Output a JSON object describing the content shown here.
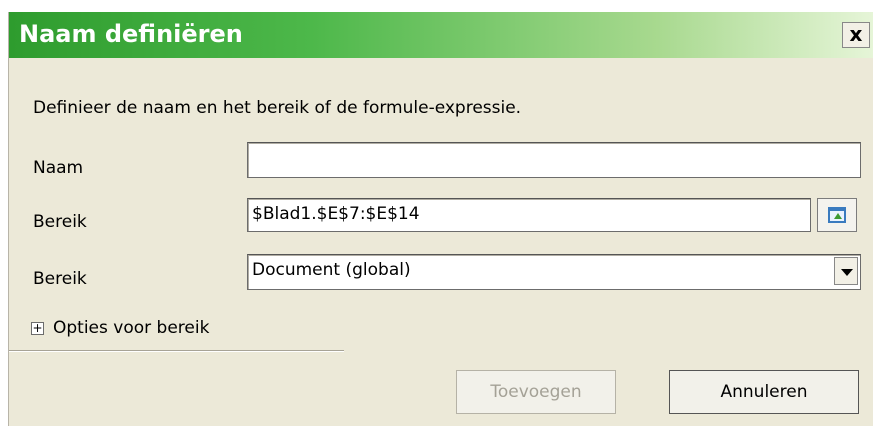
{
  "window": {
    "title": "Naam definiëren",
    "close_label": "x"
  },
  "description": "Definieer de naam en het bereik of de formule-expressie.",
  "fields": {
    "name_label": "Naam",
    "name_value": "",
    "range_label": "Bereik",
    "range_value": "$Blad1.$E$7:$E$14",
    "scope_label": "Bereik",
    "scope_value": "Document (global)"
  },
  "options": {
    "expand_symbol": "+",
    "label": "Opties voor bereik"
  },
  "buttons": {
    "add_label": "Toevoegen",
    "cancel_label": "Annuleren"
  }
}
